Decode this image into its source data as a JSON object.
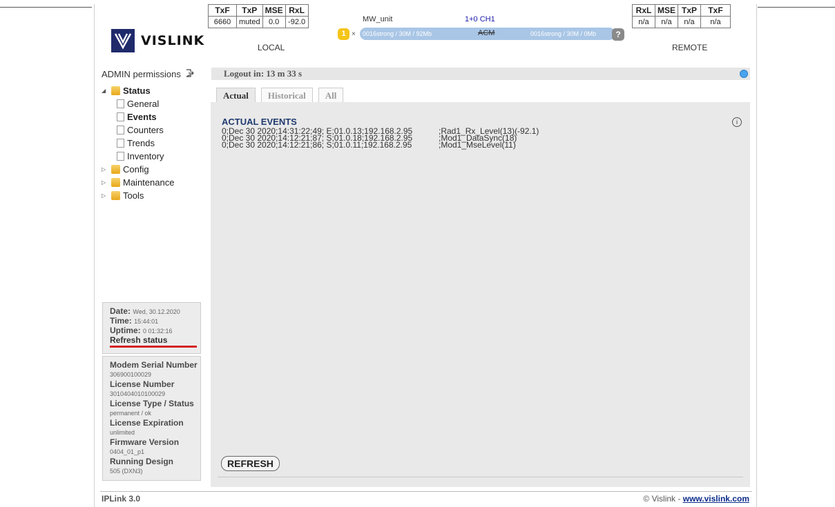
{
  "header": {
    "brand": "VISLINK",
    "local": {
      "headers": [
        "TxF",
        "TxP",
        "MSE",
        "RxL"
      ],
      "values": [
        "6660",
        "muted",
        "0.0",
        "-92.0"
      ],
      "caption": "LOCAL"
    },
    "remote": {
      "headers": [
        "RxL",
        "MSE",
        "TxP",
        "TxF"
      ],
      "values": [
        "n/a",
        "n/a",
        "n/a",
        "n/a"
      ],
      "caption": "REMOTE"
    },
    "unit_name": "MW_unit",
    "channel": "1+0 CH1",
    "badge": "1",
    "badge_x": "×",
    "link_left": "0016strong / 30M / 92Mb",
    "link_mode": "ACM",
    "link_right": "0016strong / 30M / 0Mb",
    "help": "?"
  },
  "sidebar": {
    "permissions": "ADMIN permissions",
    "tree": {
      "status": "Status",
      "general": "General",
      "events": "Events",
      "counters": "Counters",
      "trends": "Trends",
      "inventory": "Inventory",
      "config": "Config",
      "maintenance": "Maintenance",
      "tools": "Tools"
    },
    "status_box": {
      "date_label": "Date:",
      "date_value": "Wed, 30.12.2020",
      "time_label": "Time:",
      "time_value": "15:44:01",
      "uptime_label": "Uptime:",
      "uptime_value": "0 01:32:16",
      "refresh": "Refresh status"
    },
    "info_box": {
      "modem_label": "Modem Serial Number",
      "modem_value": "306900100029",
      "license_label": "License Number",
      "license_value": "3010404010100029",
      "type_label": "License Type / Status",
      "type_value": "permanent / ok",
      "exp_label": "License Expiration",
      "exp_value": "unlimited",
      "fw_label": "Firmware Version",
      "fw_value": "0404_01_p1",
      "design_label": "Running Design",
      "design_value": "505 (DXN3)"
    }
  },
  "main": {
    "logout": "Logout in: 13 m 33 s",
    "tabs": [
      "Actual",
      "Historical",
      "All"
    ],
    "panel_title": "ACTUAL EVENTS",
    "info": "i",
    "events": [
      {
        "a": "0;Dec 30 2020;14:31:22;49; E;01.0.13;192.168.2.95",
        "b": ";Rad1_Rx_Level(13)(-92.1)"
      },
      {
        "a": "0;Dec 30 2020;14:12:21;87; S;01.0.18;192.168.2.95",
        "b": ";Mod1_DataSync(18)"
      },
      {
        "a": "0;Dec 30 2020;14:12:21;86; S;01.0.11;192.168.2.95",
        "b": ";Mod1_MseLevel(11)"
      }
    ],
    "refresh_button": "REFRESH"
  },
  "footer": {
    "product": "IPLink 3.0",
    "copyright": "© Vislink - ",
    "link": "www.vislink.com"
  }
}
